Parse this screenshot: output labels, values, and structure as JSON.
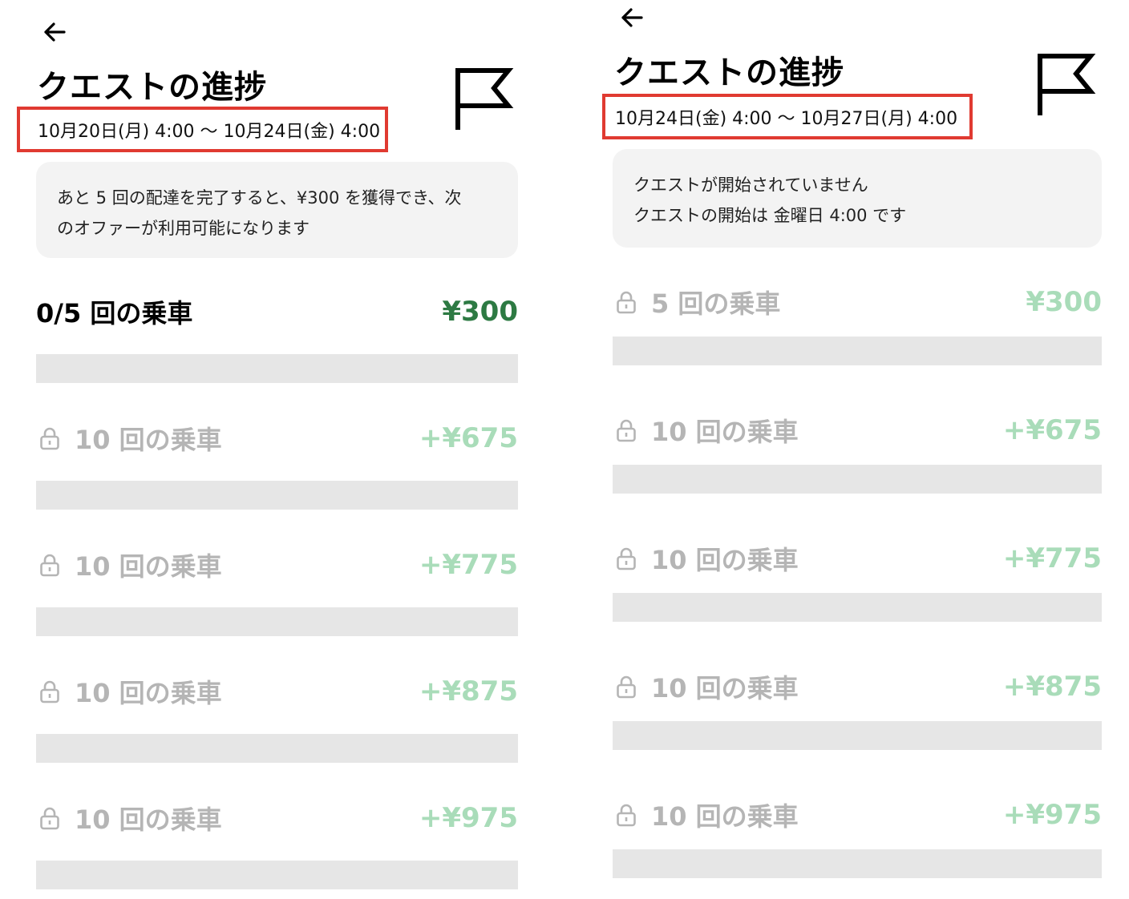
{
  "left": {
    "title": "クエストの進捗",
    "date_range": "10月20日(月) 4:00 〜 10月24日(金) 4:00",
    "info_lines": [
      "あと 5 回の配達を完了すると、¥300 を獲得でき、次",
      "のオファーが利用可能になります"
    ],
    "rows": [
      {
        "label": "0/5 回の乗車",
        "reward": "¥300",
        "locked": false
      },
      {
        "label": "10 回の乗車",
        "reward": "+¥675",
        "locked": true
      },
      {
        "label": "10 回の乗車",
        "reward": "+¥775",
        "locked": true
      },
      {
        "label": "10 回の乗車",
        "reward": "+¥875",
        "locked": true
      },
      {
        "label": "10 回の乗車",
        "reward": "+¥975",
        "locked": true
      }
    ]
  },
  "right": {
    "title": "クエストの進捗",
    "date_range": "10月24日(金) 4:00 〜 10月27日(月) 4:00",
    "info_lines": [
      "クエストが開始されていません",
      "クエストの開始は 金曜日 4:00 です"
    ],
    "rows": [
      {
        "label": "5 回の乗車",
        "reward": "¥300",
        "locked": true
      },
      {
        "label": "10 回の乗車",
        "reward": "+¥675",
        "locked": true
      },
      {
        "label": "10 回の乗車",
        "reward": "+¥775",
        "locked": true
      },
      {
        "label": "10 回の乗車",
        "reward": "+¥875",
        "locked": true
      },
      {
        "label": "10 回の乗車",
        "reward": "+¥975",
        "locked": true
      }
    ]
  },
  "icons": {
    "back": "arrow-left-icon",
    "flag": "flag-icon",
    "lock": "lock-icon"
  },
  "colors": {
    "highlight_border": "#e03a31",
    "reward_active": "#2d7a43",
    "reward_locked": "#a9dcb9",
    "label_locked": "#b5b5b5",
    "progress_track": "#e6e6e6",
    "card_bg": "#f3f3f3"
  }
}
